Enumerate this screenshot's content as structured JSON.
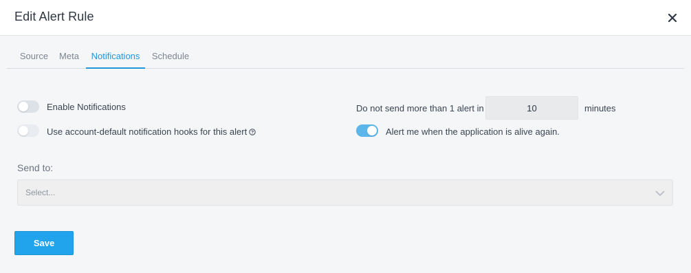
{
  "dialog": {
    "title": "Edit Alert Rule",
    "close_icon": "close-icon"
  },
  "tabs": [
    {
      "label": "Source",
      "active": false
    },
    {
      "label": "Meta",
      "active": false
    },
    {
      "label": "Notifications",
      "active": true
    },
    {
      "label": "Schedule",
      "active": false
    }
  ],
  "notifications": {
    "enable_label": "Enable Notifications",
    "enable_on": false,
    "default_hooks_label": "Use account-default notification hooks for this alert",
    "default_hooks_on": false,
    "default_hooks_help_icon": "question-circle-icon",
    "throttle_prefix": "Do not send more than 1 alert in",
    "throttle_value": "10",
    "throttle_suffix": "minutes",
    "alive_label": "Alert me when the application is alive again.",
    "alive_on": true,
    "send_to_label": "Send to:",
    "send_to_placeholder": "Select...",
    "send_to_chevron_icon": "chevron-down-icon"
  },
  "footer": {
    "save_label": "Save"
  },
  "colors": {
    "accent": "#22a4ec",
    "active_tab": "#2196d9",
    "toggle_on": "#5db6ea",
    "toggle_off": "#dde2e8"
  }
}
